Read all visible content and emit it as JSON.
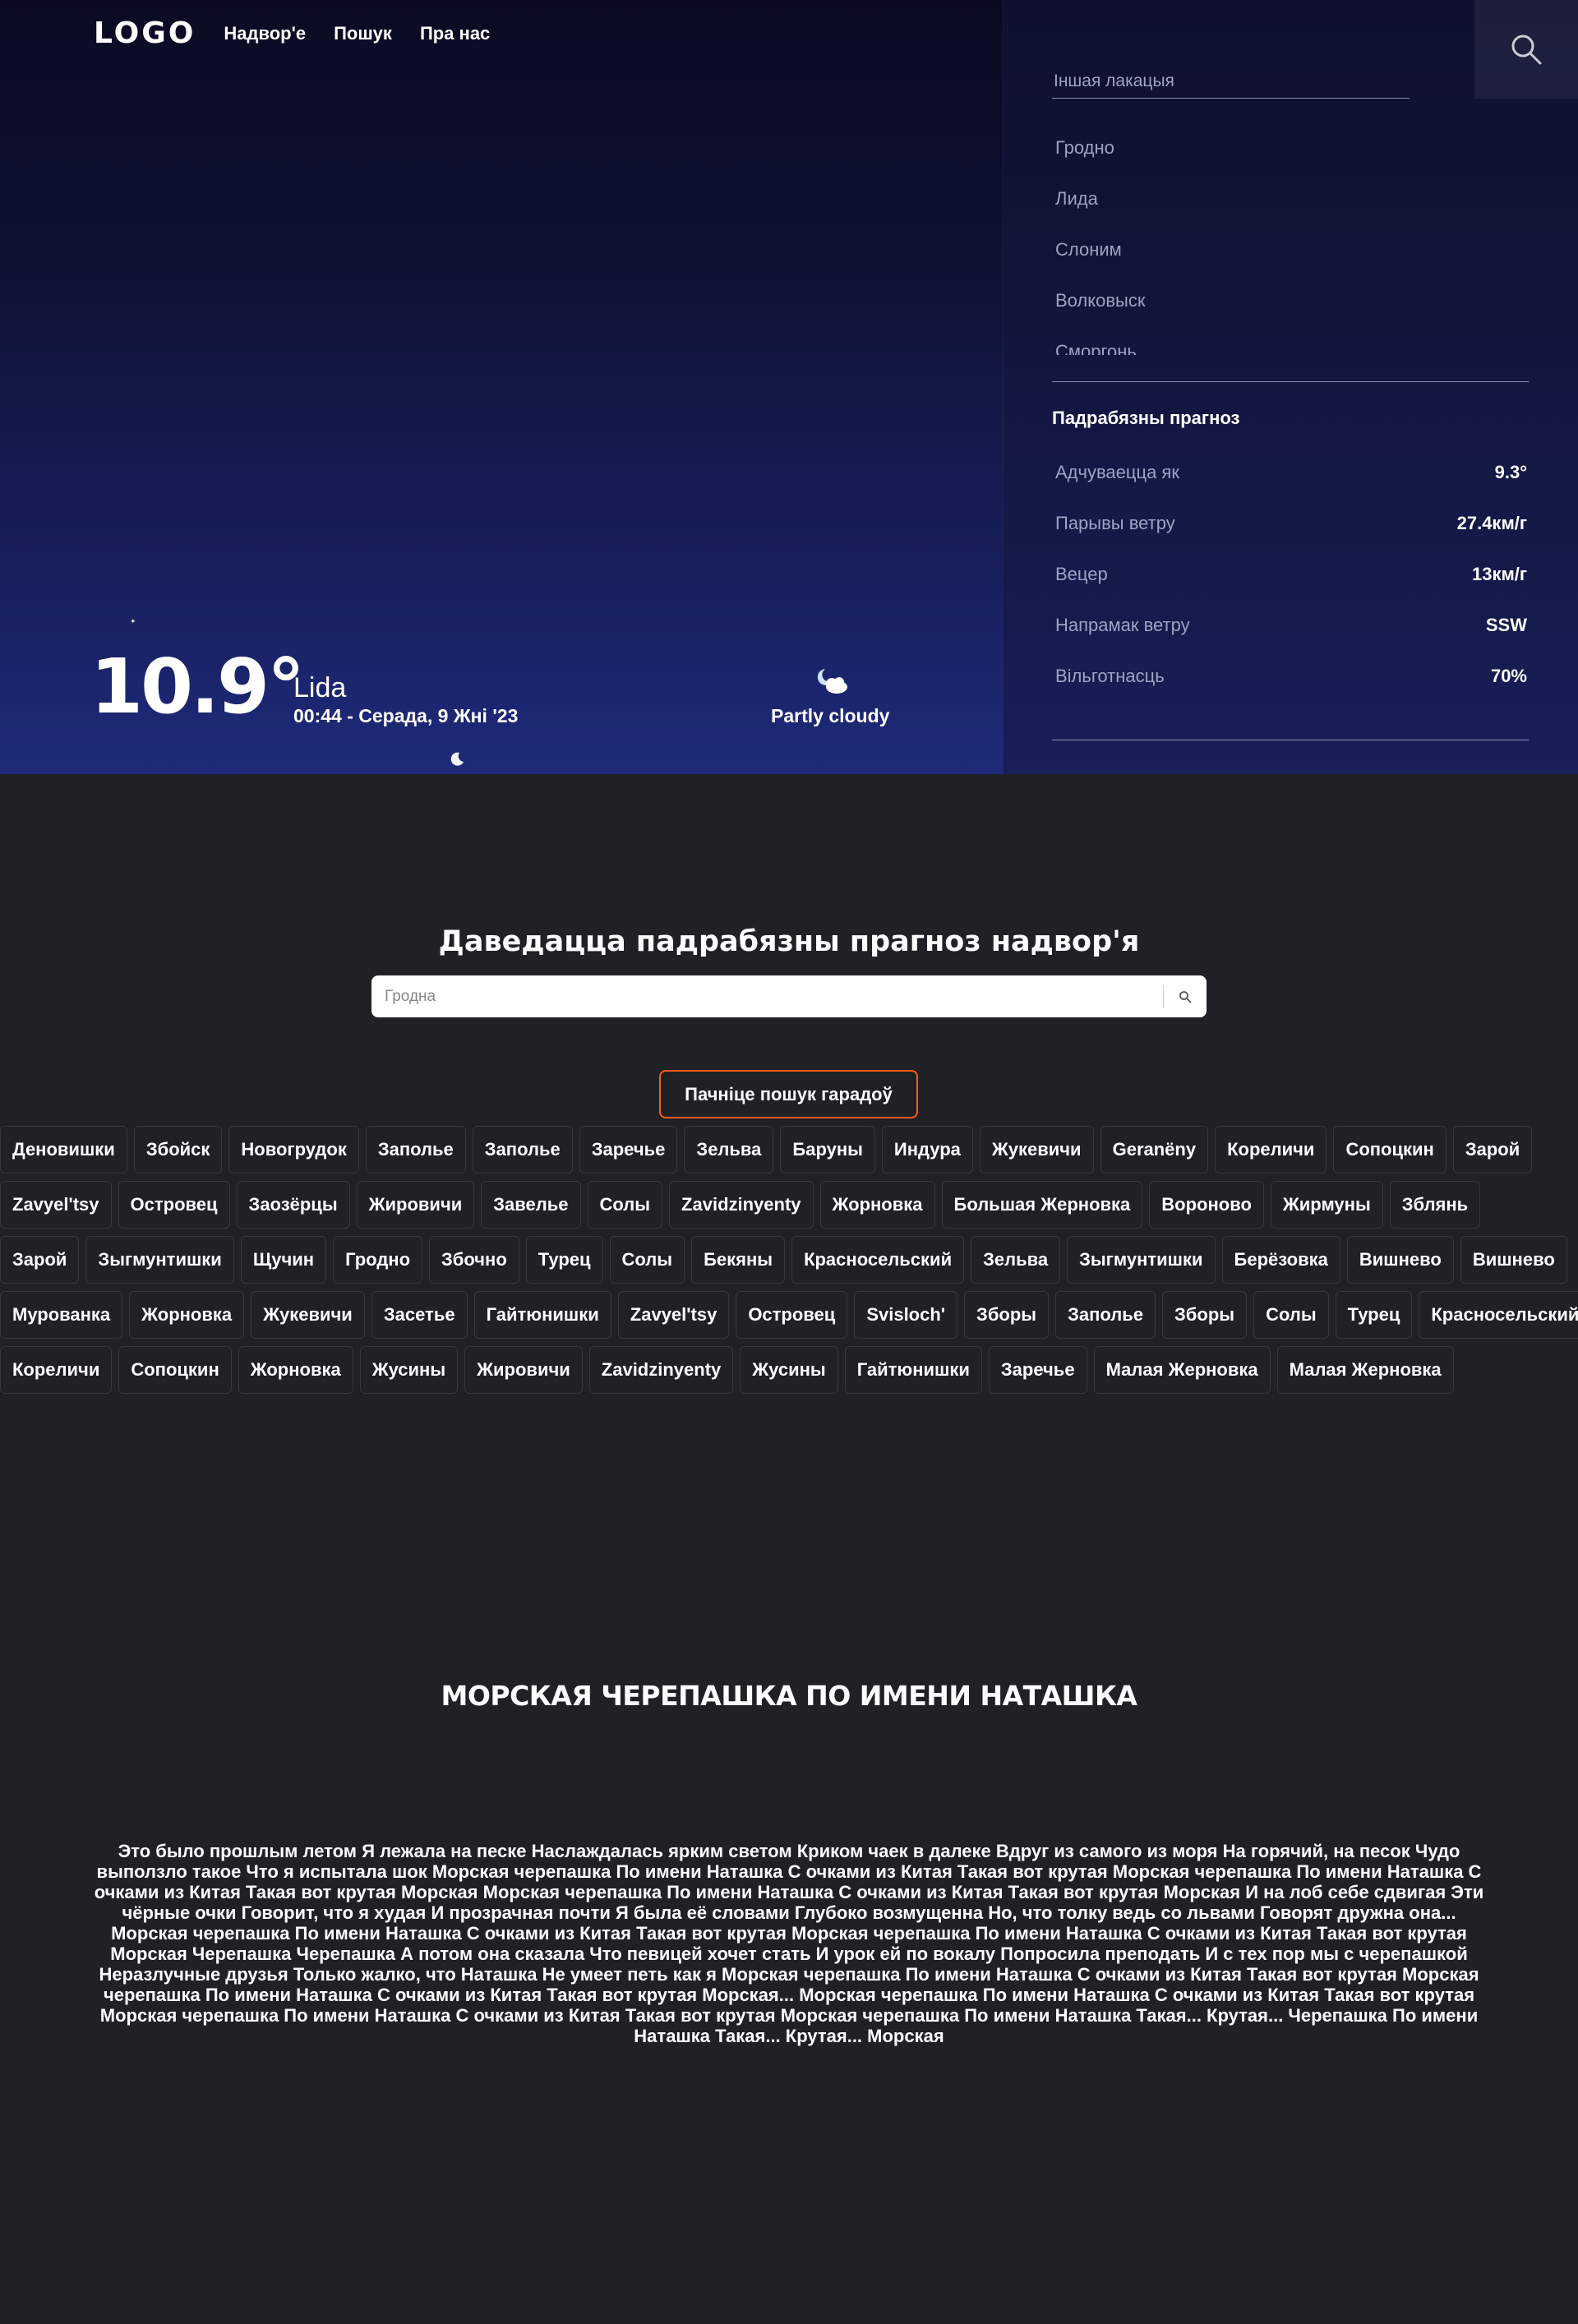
{
  "nav": {
    "logo": "LOGO",
    "links": [
      "Надвор'е",
      "Пошук",
      "Пра нас"
    ]
  },
  "current": {
    "temperature": "10.9°",
    "city": "Lida",
    "datetime": "00:44 - Серада, 9 Жні '23",
    "condition": "Partly cloudy",
    "condition_icon": "partly-cloudy-night-icon"
  },
  "panel": {
    "location_placeholder": "Іншая лакацыя",
    "locations": [
      "Гродно",
      "Лида",
      "Слоним",
      "Волковыск",
      "Сморгонь"
    ],
    "details_title": "Падрабязны прагноз",
    "details": [
      {
        "label": "Адчуваецца як",
        "value": "9.3°"
      },
      {
        "label": "Парывы ветру",
        "value": "27.4км/г"
      },
      {
        "label": "Вецер",
        "value": "13км/г"
      },
      {
        "label": "Напрамак ветру",
        "value": "SSW"
      },
      {
        "label": "Вільготнасць",
        "value": "70%"
      }
    ]
  },
  "search": {
    "title": "Даведацца падрабязны прагноз надвор'я",
    "placeholder": "Гродна",
    "start_label": "Пачніце пошук гарадоў"
  },
  "chips": [
    [
      "Деновишки",
      "Збойск",
      "Новогрудок",
      "Заполье",
      "Заполье",
      "Заречье",
      "Зельва",
      "Баруны",
      "Индура",
      "Жукевичи",
      "Geranëny",
      "Кореличи",
      "Сопоцкин",
      "Зарой"
    ],
    [
      "Zavyel'tsy",
      "Островец",
      "Заозёрцы",
      "Жировичи",
      "Завелье",
      "Солы",
      "Zavidzinyenty",
      "Жорновка",
      "Большая Жерновка",
      "Вороново",
      "Жирмуны",
      "Зблянь"
    ],
    [
      "Зарой",
      "Зыгмунтишки",
      "Щучин",
      "Гродно",
      "Збочно",
      "Турец",
      "Солы",
      "Бекяны",
      "Красносельский",
      "Зельва",
      "Зыгмунтишки",
      "Берёзовка",
      "Вишнево",
      "Вишнево"
    ],
    [
      "Мурованка",
      "Жорновка",
      "Жукевичи",
      "Засетье",
      "Гайтюнишки",
      "Zavyel'tsy",
      "Островец",
      "Svisloch'",
      "Зборы",
      "Заполье",
      "Зборы",
      "Солы",
      "Турец",
      "Красносельский"
    ],
    [
      "Кореличи",
      "Сопоцкин",
      "Жорновка",
      "Жусины",
      "Жировичи",
      "Zavidzinyenty",
      "Жусины",
      "Гайтюнишки",
      "Заречье",
      "Малая Жерновка",
      "Малая Жерновка"
    ]
  ],
  "article": {
    "title": "МОРСКАЯ ЧЕРЕПАШКА ПО ИМЕНИ НАТАШКА",
    "body": "Это было прошлым летом Я лежала на песке Наслаждалась ярким светом Криком чаек в далеке Вдруг из самого из моря На горячий, на песок Чудо выползло такое Что я испытала шок Морская черепашка По имени Наташка С очками из Китая Такая вот крутая Морская черепашка По имени Наташка С очками из Китая Такая вот крутая Морская Морская черепашка По имени Наташка С очками из Китая Такая вот крутая Морская И на лоб себе сдвигая Эти чёрные очки Говорит, что я худая И прозрачная почти Я была её словами Глубоко возмущенна Но, что толку ведь со львами Говорят дружна она... Морская черепашка По имени Наташка С очками из Китая Такая вот крутая Морская черепашка По имени Наташка С очками из Китая Такая вот крутая Морская Черепашка Черепашка А потом она сказала Что певицей хочет стать И урок ей по вокалу Попросила преподать И с тех пор мы с черепашкой Неразлучные друзья Только жалко, что Наташка Не умеет петь как я Морская черепашка По имени Наташка С очками из Китая Такая вот крутая Морская черепашка По имени Наташка С очками из Китая Такая вот крутая Морская... Морская черепашка По имени Наташка С очками из Китая Такая вот крутая Морская черепашка По имени Наташка С очками из Китая Такая вот крутая Морская черепашка По имени Наташка Такая... Крутая... Черепашка По имени Наташка Такая... Крутая... Морская"
  },
  "colors": {
    "hero_top": "#0a0b22",
    "hero_bottom": "#1f2a7a",
    "page_bg": "#1f2125",
    "accent_border": "#ff5a1f",
    "muted_text": "#9ea3c4"
  }
}
